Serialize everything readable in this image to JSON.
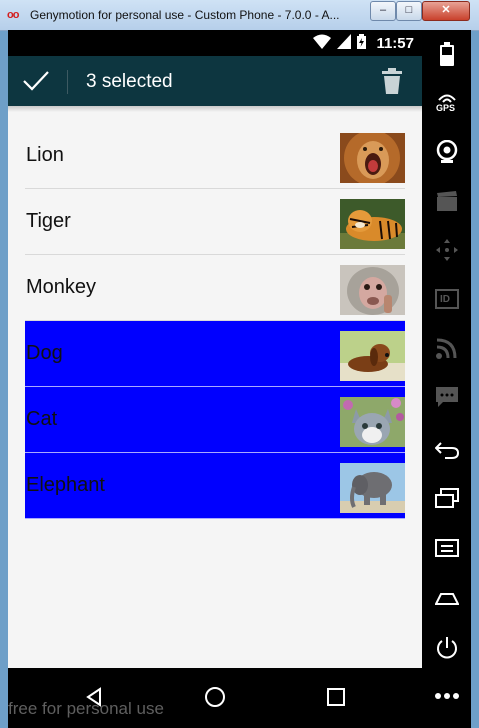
{
  "window": {
    "title": "Genymotion for personal use - Custom Phone - 7.0.0 - A...",
    "app_icon": "oo",
    "minimize": "–",
    "maximize": "□",
    "close": "✕"
  },
  "status_bar": {
    "time": "11:57"
  },
  "action_bar": {
    "title": "3 selected"
  },
  "items": [
    {
      "label": "Lion",
      "selected": false
    },
    {
      "label": "Tiger",
      "selected": false
    },
    {
      "label": "Monkey",
      "selected": false
    },
    {
      "label": "Dog",
      "selected": true
    },
    {
      "label": "Cat",
      "selected": true
    },
    {
      "label": "Elephant",
      "selected": true
    }
  ],
  "side_panel": {
    "gps_label": "GPS",
    "id_label": "ID"
  },
  "watermark": "free for personal use",
  "colors": {
    "action_bar": "#0d3640",
    "selected_row": "#0000ff",
    "status_bar": "#000000"
  }
}
